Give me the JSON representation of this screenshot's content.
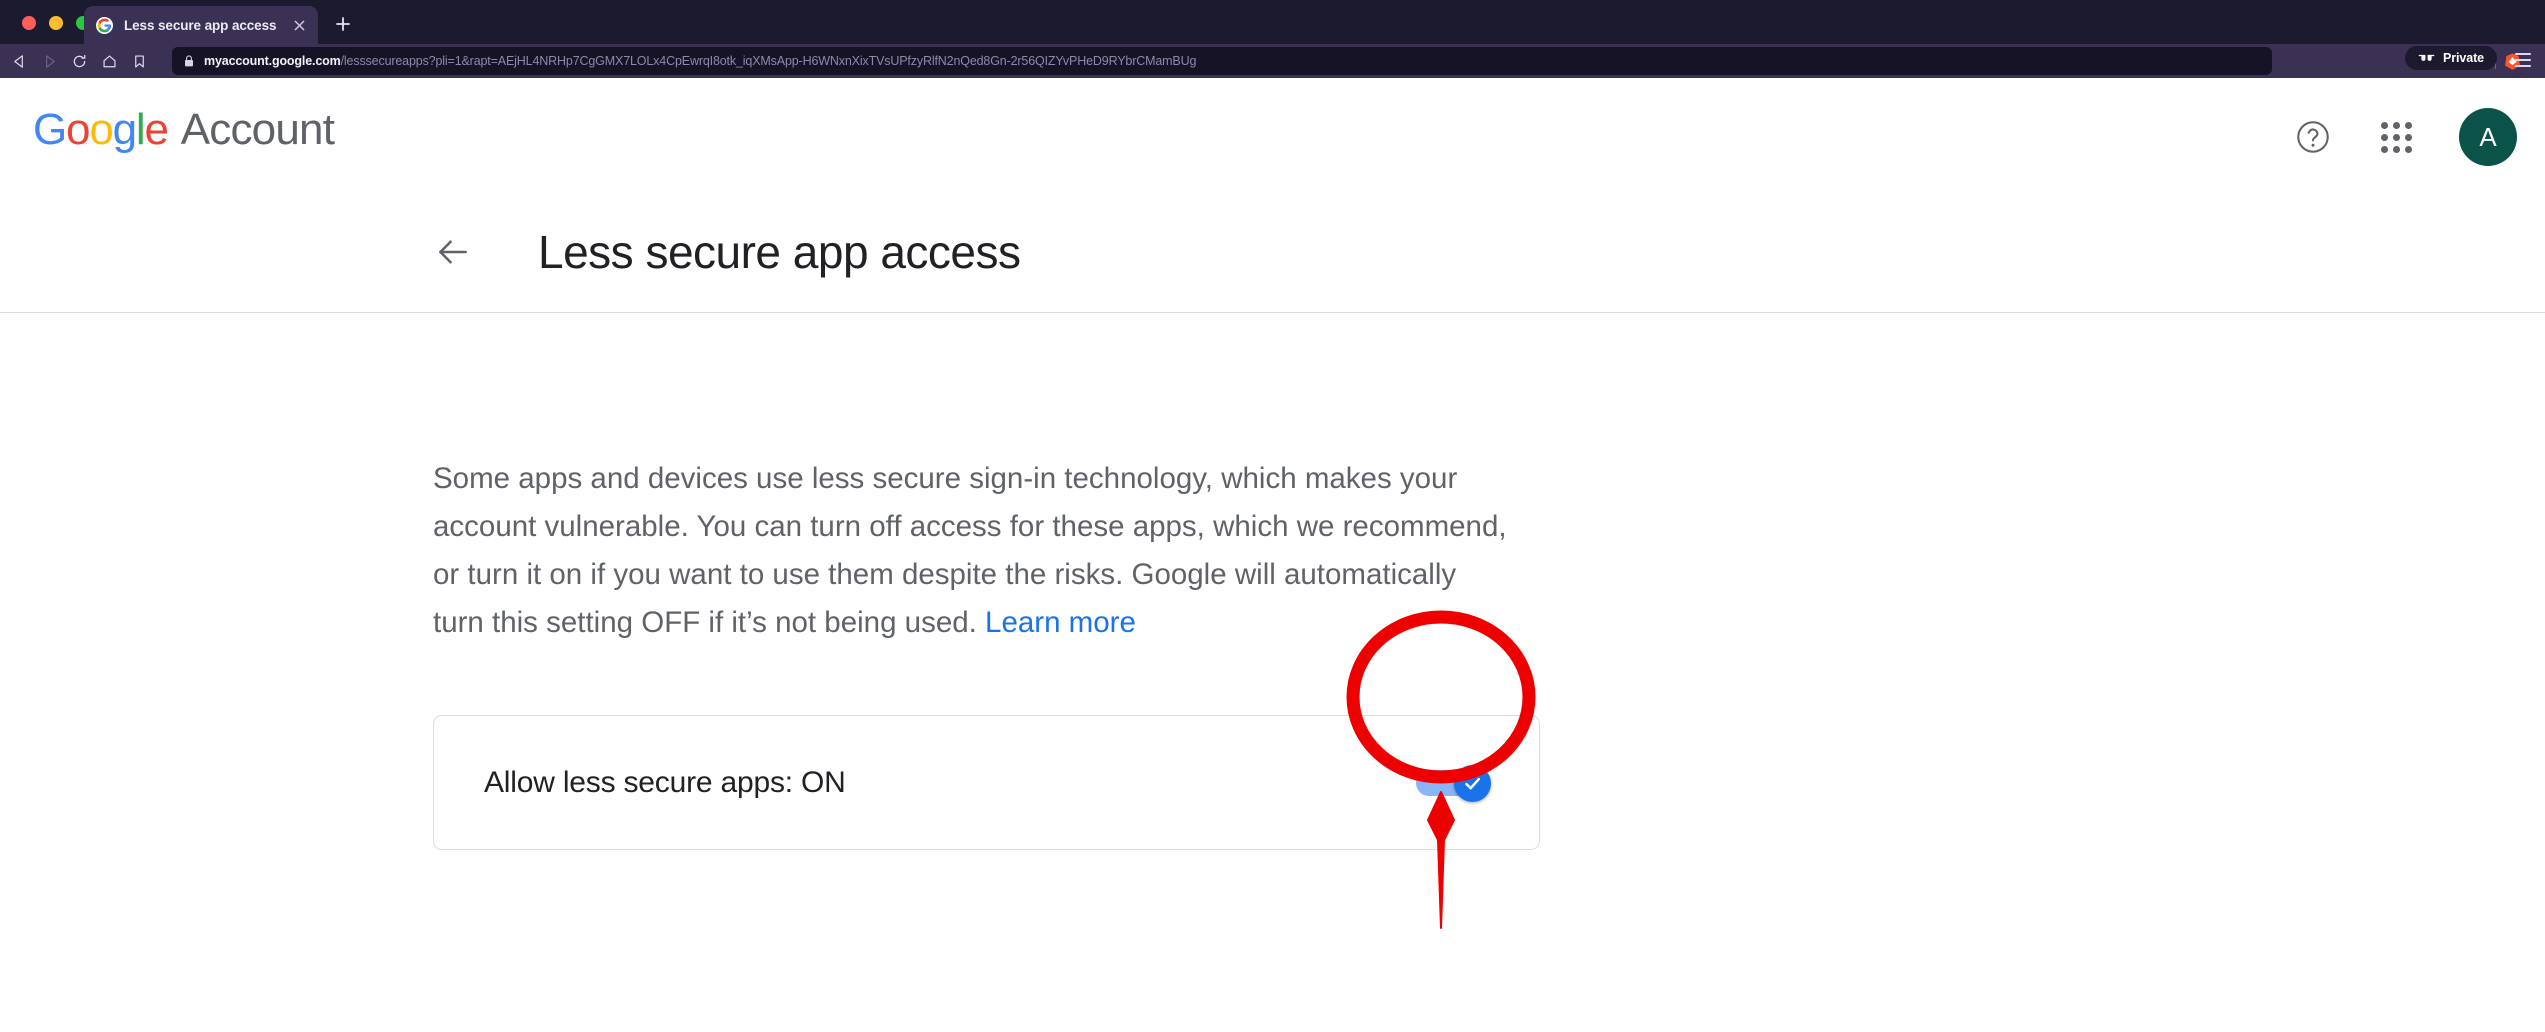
{
  "browser": {
    "name": "brave-browser",
    "tab": {
      "title": "Less secure app access",
      "favicon": "google-g-icon",
      "close_label": "×"
    },
    "new_tab_label": "+",
    "nav": {
      "back": "back-icon",
      "forward": "forward-icon",
      "reload": "reload-icon",
      "home": "home-icon",
      "bookmark": "bookmark-icon"
    },
    "omnibox": {
      "lock": "lock-icon",
      "host": "myaccount.google.com",
      "path": "/lesssecureapps?pli=1&rapt=AEjHL4NRHp7CgGMX7LOLx4CpEwrqI8otk_iqXMsApp-H6WNxnXixTVsUPfzyRlfN2nQed8Gn-2r56QIZYvPHeD9RYbrCMamBUg",
      "full_url": "myaccount.google.com/lesssecureapps?pli=1&rapt=AEjHL4NRHp7CgGMX7LOLx4CpEwrqI8otk_iqXMsApp-H6WNxnXixTVsUPfzyRlfN2nQed8Gn-2r56QIZYvPHeD9RYbrCMamBUg"
    },
    "actions": {
      "zoom_icon": "zoom-search-icon",
      "brave_shields_icon": "brave-lion-icon",
      "private_label": "Private",
      "private_icon": "sunglasses-icon",
      "menu_icon": "hamburger-menu-icon"
    },
    "colors": {
      "titlebar": "#1c1a2e",
      "toolbar": "#3b3154",
      "omnibox": "#161326",
      "brave_orange": "#fb542b"
    }
  },
  "header": {
    "logo": {
      "google": "Google",
      "letters": [
        "G",
        "o",
        "o",
        "g",
        "l",
        "e"
      ],
      "product": "Account"
    },
    "help_icon": "help-question-icon",
    "apps_icon": "google-apps-grid-icon",
    "avatar_letter": "A",
    "avatar_color": "#0b5249"
  },
  "page": {
    "back_icon": "back-arrow-icon",
    "title": "Less secure app access",
    "description": {
      "text": "Some apps and devices use less secure sign-in technology, which makes your account vulnerable. You can turn off access for these apps, which we recommend, or turn it on if you want to use them despite the risks. Google will automatically turn this setting OFF if it’s not being used. ",
      "link_label": "Learn more",
      "link_color": "#1a73e8"
    },
    "setting": {
      "label": "Allow less secure apps: ON",
      "toggle_state": "on",
      "toggle_icon": "check-icon",
      "toggle_on_color": "#1a73e8",
      "toggle_track_color": "#8ab4f8"
    }
  },
  "annotation": {
    "circle_label": "red-highlight-circle",
    "arrow_label": "red-pointer-arrow",
    "color": "#ee0000"
  }
}
